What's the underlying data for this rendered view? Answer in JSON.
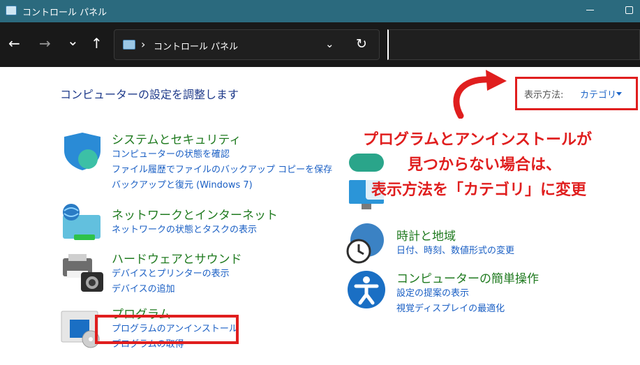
{
  "window": {
    "title": "コントロール パネル"
  },
  "nav": {
    "back_glyph": "←",
    "forward_glyph": "→",
    "recent_glyph": "⌄",
    "up_glyph": "↑",
    "address_path": "コントロール パネル",
    "address_chevron": "›",
    "dropdown_glyph": "⌄",
    "refresh_glyph": "↻",
    "search_value": ""
  },
  "main": {
    "heading": "コンピューターの設定を調整します",
    "view_by_label": "表示方法:",
    "view_by_value": "カテゴリ"
  },
  "categories": [
    {
      "title": "システムとセキュリティ",
      "links": [
        "コンピューターの状態を確認",
        "ファイル履歴でファイルのバックアップ コピーを保存",
        "バックアップと復元 (Windows 7)"
      ]
    },
    {
      "title": "ネットワークとインターネット",
      "links": [
        "ネットワークの状態とタスクの表示"
      ]
    },
    {
      "title": "ハードウェアとサウンド",
      "links": [
        "デバイスとプリンターの表示",
        "デバイスの追加"
      ]
    },
    {
      "title": "プログラム",
      "links": [
        "プログラムのアンインストール",
        "プログラムの取得"
      ]
    },
    {
      "title": "時計と地域",
      "links": [
        "日付、時刻、数値形式の変更"
      ]
    },
    {
      "title": "コンピューターの簡単操作",
      "links": [
        "設定の提案の表示",
        "視覚ディスプレイの最適化"
      ]
    }
  ],
  "annotation": {
    "lines": [
      "プログラムとアンインストールが",
      "見つからない場合は、",
      "表示方法を「カテゴリ」に変更"
    ],
    "color": "#e01e1e"
  },
  "colors": {
    "titlebar": "#2b6a7e",
    "navbar": "#191919",
    "category_title": "#1f7a1f",
    "link": "#1a5fc4"
  }
}
